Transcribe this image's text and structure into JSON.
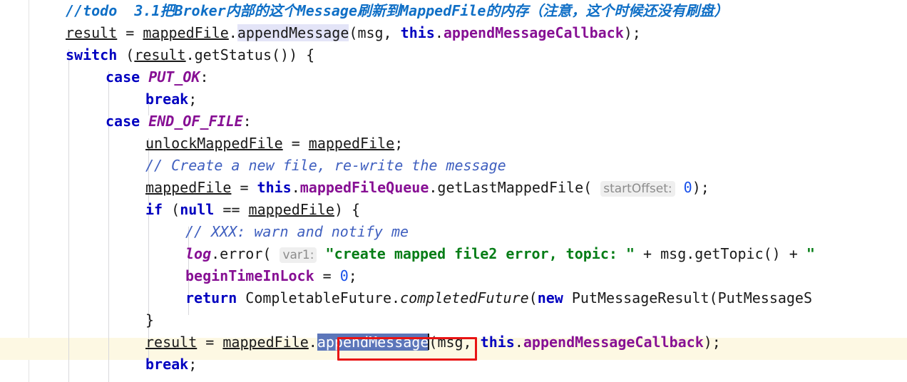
{
  "editor": {
    "language": "java",
    "font_size_px": 20,
    "line_height_px": 31,
    "colors": {
      "background": "#ffffff",
      "default_text": "#1a1a1a",
      "keyword": "#0000c0",
      "field": "#871094",
      "constant": "#871094",
      "string": "#067d17",
      "number": "#1750eb",
      "comment": "#3f5fbf",
      "todo_comment": "#0f6fc6",
      "usage_highlight": "#e3e4f7",
      "current_line": "#fdf8e3",
      "selection": "#5c76ba",
      "selection_text": "#ffffff",
      "inlay_hint_bg": "#efefef",
      "inlay_hint_text": "#8c8c8c",
      "annotation_box": "#e81313",
      "indent_guide": "#d8d8dc",
      "gutter_rule": "#e4e4e4"
    }
  },
  "annotation": {
    "shape": "rectangle",
    "color": "#e81313",
    "target_text": ".appendMessage"
  },
  "caret": {
    "after_text": "appendMessage"
  },
  "selection": {
    "text": "appendMessage"
  },
  "inlay_hints": [
    {
      "label": "startOffset:",
      "value": "0"
    },
    {
      "label": "var1:",
      "value": "\"create mapped file2 error, topic: \""
    }
  ],
  "code_lines": [
    {
      "id": "line-todo-comment",
      "indent": 0,
      "text": "//todo  3.1把Broker内部的这个Message刷新到MappedFile的内存（注意，这个时候还没有刷盘）",
      "kind": "todo-comment"
    },
    {
      "id": "line-append-message-1",
      "indent": 0,
      "text": "result = mappedFile.appendMessage(msg, this.appendMessageCallback);",
      "kind": "code"
    },
    {
      "id": "line-switch",
      "indent": 0,
      "text": "switch (result.getStatus()) {",
      "kind": "code"
    },
    {
      "id": "line-case-put-ok",
      "indent": 1,
      "text": "case PUT_OK:",
      "kind": "code"
    },
    {
      "id": "line-break-1",
      "indent": 2,
      "text": "break;",
      "kind": "code"
    },
    {
      "id": "line-case-end-of-file",
      "indent": 1,
      "text": "case END_OF_FILE:",
      "kind": "code"
    },
    {
      "id": "line-unlock-mapped-file",
      "indent": 2,
      "text": "unlockMappedFile = mappedFile;",
      "kind": "code"
    },
    {
      "id": "line-comment-create-new-file",
      "indent": 2,
      "text": "// Create a new file, re-write the message",
      "kind": "comment"
    },
    {
      "id": "line-get-last-mapped-file",
      "indent": 2,
      "text": "mappedFile = this.mappedFileQueue.getLastMappedFile( startOffset: 0);",
      "kind": "code"
    },
    {
      "id": "line-if-null",
      "indent": 2,
      "text": "if (null == mappedFile) {",
      "kind": "code"
    },
    {
      "id": "line-comment-xxx",
      "indent": 3,
      "text": "// XXX: warn and notify me",
      "kind": "comment"
    },
    {
      "id": "line-log-error",
      "indent": 3,
      "text": "log.error( var1: \"create mapped file2 error, topic: \" + msg.getTopic() + \"",
      "kind": "code",
      "clipped": true
    },
    {
      "id": "line-begin-time-in-lock",
      "indent": 3,
      "text": "beginTimeInLock = 0;",
      "kind": "code"
    },
    {
      "id": "line-return-completable-future",
      "indent": 3,
      "text": "return CompletableFuture.completedFuture(new PutMessageResult(PutMessageS",
      "kind": "code",
      "clipped": true
    },
    {
      "id": "line-close-brace",
      "indent": 2,
      "text": "}",
      "kind": "code"
    },
    {
      "id": "line-append-message-2",
      "indent": 2,
      "text": "result = mappedFile.appendMessage(msg, this.appendMessageCallback);",
      "kind": "code",
      "current_line": true
    },
    {
      "id": "line-break-2",
      "indent": 2,
      "text": "break;",
      "kind": "code"
    }
  ],
  "tokens": {
    "todo_prefix": "//todo  3.1",
    "todo_rest": "把Broker内部的这个Message刷新到MappedFile的内存（注意，这个时候还没有刷盘）",
    "result": "result",
    "eq": " = ",
    "mappedFile": "mappedFile",
    "dot": ".",
    "appendMessage": "appendMessage",
    "open_paren": "(",
    "msg_comma": "msg, ",
    "this": "this",
    "appendMessageCallback": "appendMessageCallback",
    "close_paren_semi": ");",
    "switch": "switch",
    "switch_open": " (",
    "getStatus": ".getStatus()) {",
    "case": "case",
    "put_ok": "PUT_OK",
    "colon": ":",
    "break": "break",
    "semi": ";",
    "end_of_file": "END_OF_FILE",
    "unlockMappedFile": "unlockMappedFile",
    "mappedFile_semi": ";",
    "comment_create": "// Create a new file, re-write the message",
    "mappedFileQueue": "mappedFileQueue",
    "getLastMappedFile": ".getLastMappedFile(",
    "startOffset_label": "startOffset:",
    "zero": "0",
    "if": "if",
    "if_open": " (",
    "null": "null",
    "eqeq": " == ",
    "if_close": ") {",
    "comment_xxx": "// XXX: warn and notify me",
    "log": "log",
    "error_call": ".error(",
    "var1_label": "var1:",
    "error_string": "\"create mapped file2 error, topic: \"",
    "plus": " + ",
    "getTopic": "msg.getTopic()",
    "plus2": " + ",
    "quote": "\"",
    "beginTimeInLock": "beginTimeInLock",
    "return": "return",
    "completable_future": " CompletableFuture.",
    "completedFuture": "completedFuture",
    "new": "new",
    "put_message_result": " PutMessageResult(PutMessageS",
    "close_brace": "}"
  }
}
